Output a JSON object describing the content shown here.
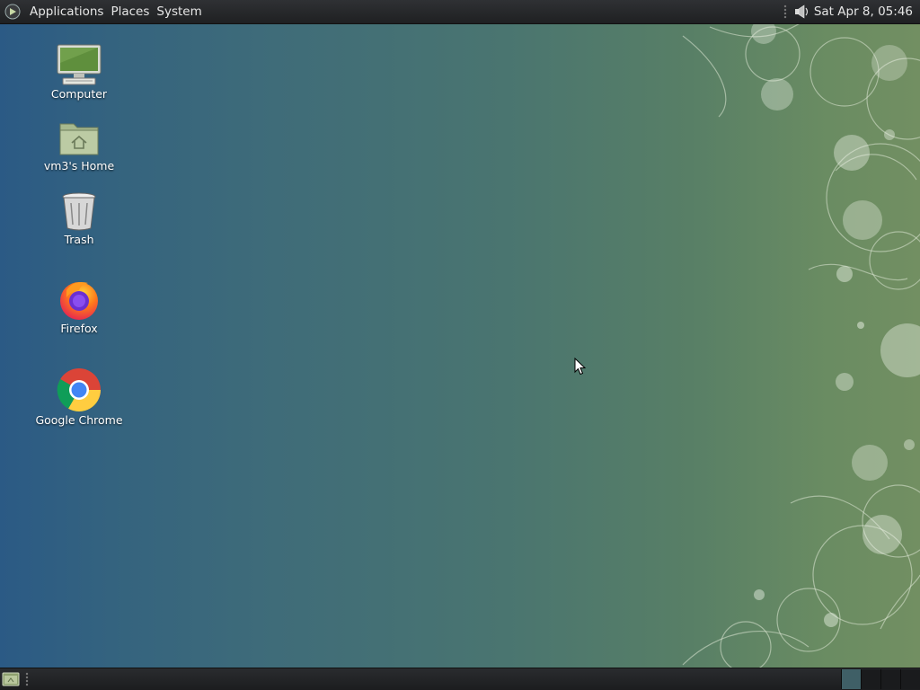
{
  "top_panel": {
    "menus": [
      "Applications",
      "Places",
      "System"
    ],
    "clock": "Sat Apr  8, 05:46",
    "icons": {
      "menu": "gnome-foot-icon",
      "volume": "speaker-icon"
    }
  },
  "desktop": {
    "icons": [
      {
        "label": "Computer",
        "icon": "computer-icon"
      },
      {
        "label": "vm3's Home",
        "icon": "home-folder-icon"
      },
      {
        "label": "Trash",
        "icon": "trash-icon"
      },
      {
        "label": "Firefox",
        "icon": "firefox-icon"
      },
      {
        "label": "Google Chrome",
        "icon": "chrome-icon"
      }
    ]
  },
  "bottom_panel": {
    "show_desktop_icon": "show-desktop-icon",
    "workspaces": [
      {
        "active": true
      },
      {
        "active": false
      },
      {
        "active": false
      },
      {
        "active": false
      }
    ]
  },
  "colors": {
    "wallpaper_left": "#2b5a85",
    "wallpaper_right": "#728f62",
    "panel": "#262729"
  }
}
